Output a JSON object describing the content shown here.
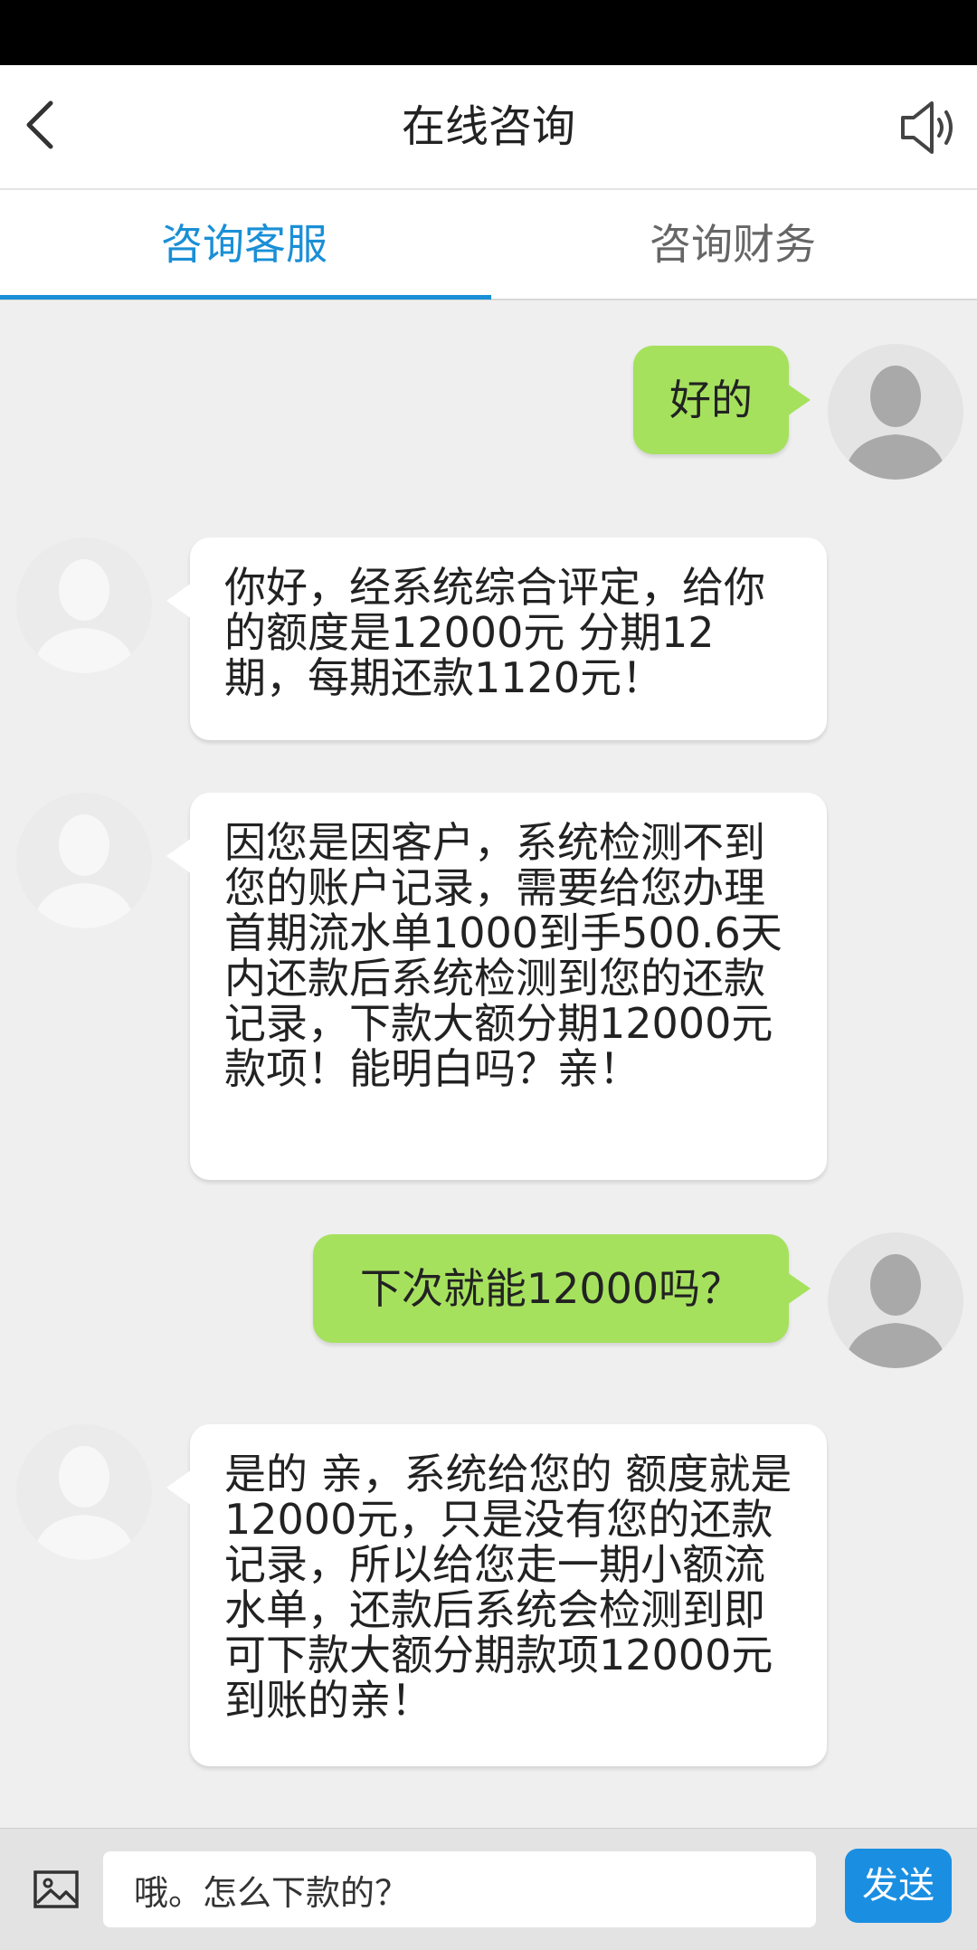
{
  "header": {
    "title": "在线咨询"
  },
  "tabs": [
    {
      "label": "咨询客服"
    },
    {
      "label": "咨询财务"
    }
  ],
  "messages": [
    {
      "from": "user",
      "text": "好的"
    },
    {
      "from": "agent",
      "text": "你好，经系统综合评定，给你的额度是12000元 分期12期，每期还款1120元！"
    },
    {
      "from": "agent",
      "text": "因您是因客户，系统检测不到您的账户记录，需要给您办理首期流水单1000到手500.6天内还款后系统检测到您的还款记录，下款大额分期12000元款项！能明白吗？亲！"
    },
    {
      "from": "user",
      "text": "下次就能12000吗？"
    },
    {
      "from": "agent",
      "text": "是的 亲，系统给您的 额度就是12000元，只是没有您的还款记录，所以给您走一期小额流水单，还款后系统会检测到即可下款大额分期款项12000元到账的亲！"
    }
  ],
  "input": {
    "value": "哦。怎么下款的？",
    "send_label": "发送"
  },
  "colors": {
    "accent": "#1a8fd6",
    "outgoing_bubble": "#a6e15e",
    "send_button": "#1a8fe2"
  }
}
